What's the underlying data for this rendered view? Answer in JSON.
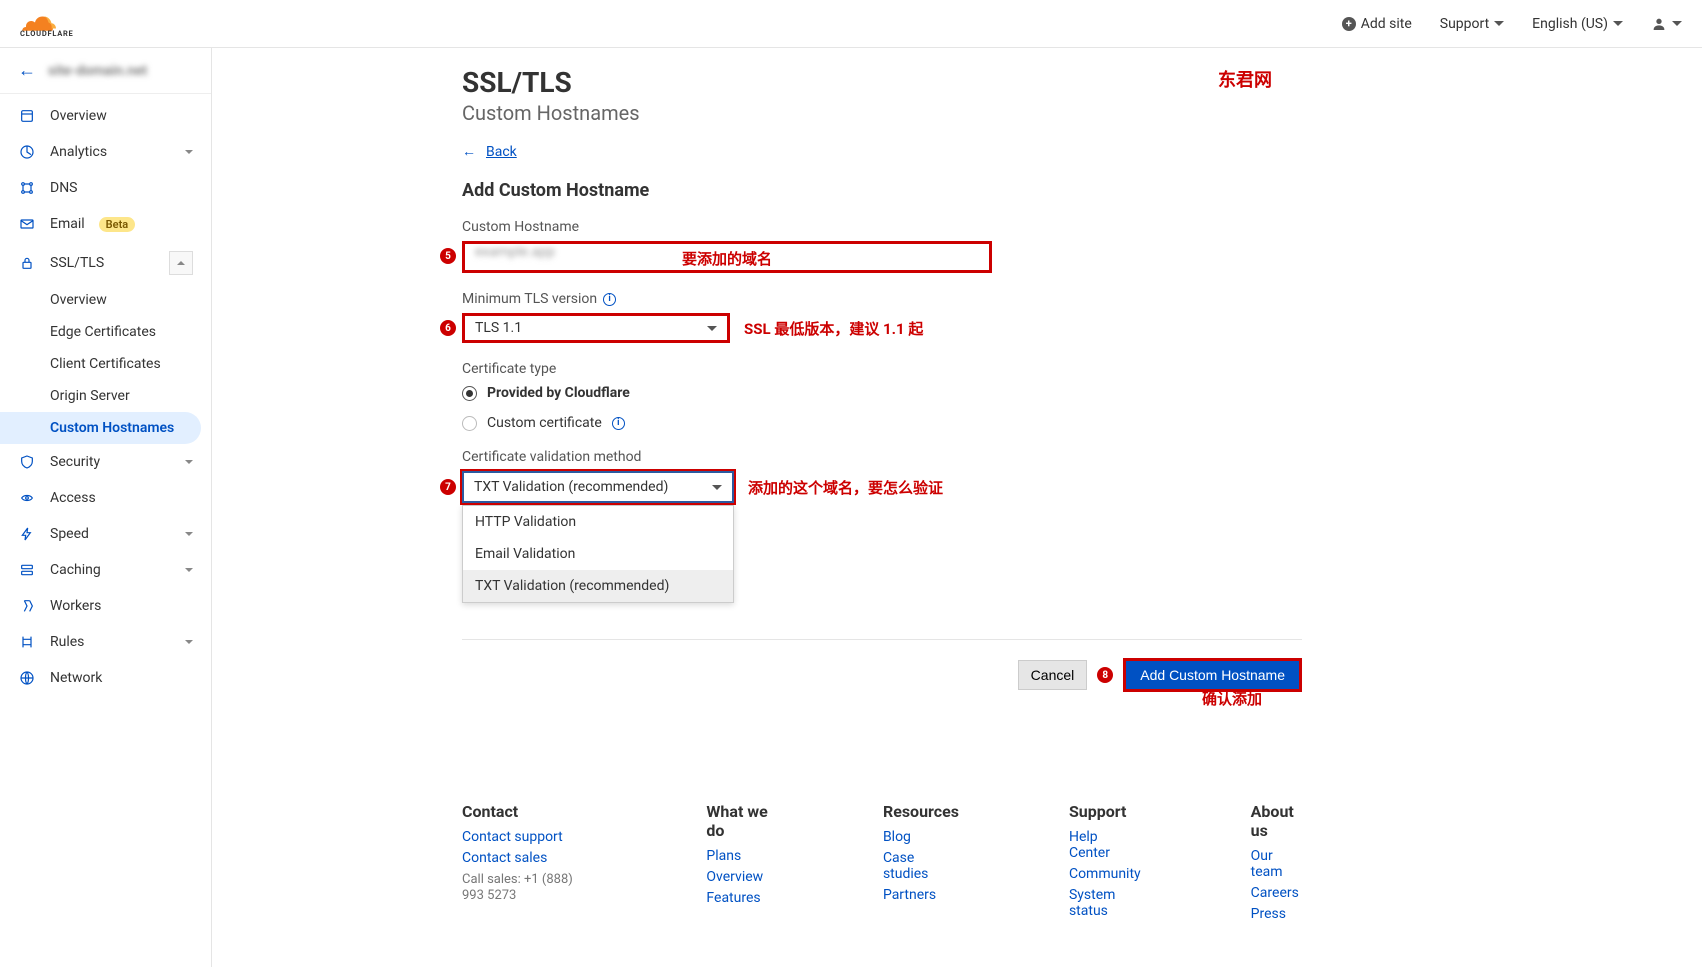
{
  "topbar": {
    "add_site": "Add site",
    "support": "Support",
    "language": "English (US)"
  },
  "sidebar": {
    "site": "site-domain.net",
    "items": {
      "overview": "Overview",
      "analytics": "Analytics",
      "dns": "DNS",
      "email": "Email",
      "email_badge": "Beta",
      "ssl": "SSL/TLS",
      "security": "Security",
      "access": "Access",
      "speed": "Speed",
      "caching": "Caching",
      "workers": "Workers",
      "rules": "Rules",
      "network": "Network"
    },
    "ssl_sub": {
      "overview": "Overview",
      "edge": "Edge Certificates",
      "client": "Client Certificates",
      "origin": "Origin Server",
      "custom": "Custom Hostnames"
    }
  },
  "page": {
    "title": "SSL/TLS",
    "subtitle": "Custom Hostnames",
    "back": "Back",
    "heading": "Add Custom Hostname",
    "watermark": "东君网"
  },
  "form": {
    "hostname_label": "Custom Hostname",
    "hostname_value": "example.app",
    "tls_label": "Minimum TLS version",
    "tls_value": "TLS 1.1",
    "cert_type_label": "Certificate type",
    "cert_cloudflare": "Provided by Cloudflare",
    "cert_custom": "Custom certificate",
    "validation_label": "Certificate validation method",
    "validation_value": "TXT Validation (recommended)",
    "validation_options": {
      "http": "HTTP Validation",
      "email": "Email Validation",
      "txt": "TXT Validation (recommended)"
    }
  },
  "annotations": {
    "hostname": "要添加的域名",
    "tls": "SSL 最低版本，建议 1.1 起",
    "validation": "添加的这个域名，要怎么验证",
    "confirm": "确认添加",
    "n5": "5",
    "n6": "6",
    "n7": "7",
    "n8": "8"
  },
  "actions": {
    "cancel": "Cancel",
    "submit": "Add Custom Hostname"
  },
  "footer": {
    "contact": {
      "title": "Contact",
      "l1": "Contact support",
      "l2": "Contact sales",
      "l3": "Call sales: +1 (888) 993 5273"
    },
    "whatwedo": {
      "title": "What we do",
      "l1": "Plans",
      "l2": "Overview",
      "l3": "Features"
    },
    "resources": {
      "title": "Resources",
      "l1": "Blog",
      "l2": "Case studies",
      "l3": "Partners"
    },
    "support": {
      "title": "Support",
      "l1": "Help Center",
      "l2": "Community",
      "l3": "System status"
    },
    "about": {
      "title": "About us",
      "l1": "Our team",
      "l2": "Careers",
      "l3": "Press"
    }
  }
}
